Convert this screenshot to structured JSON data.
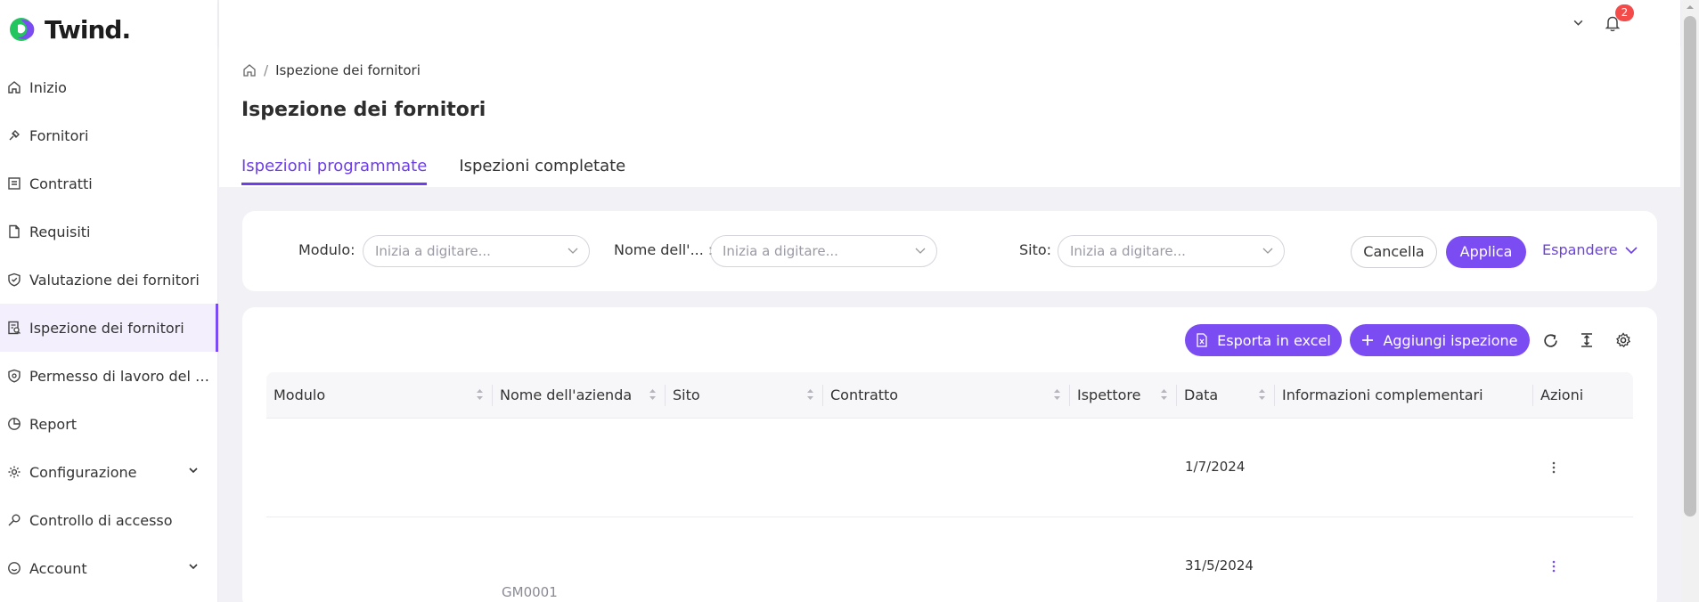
{
  "brand": {
    "name": "Twind.",
    "logo_colors": [
      "#22c55e",
      "#7b4cf2"
    ]
  },
  "sidebar": {
    "items": [
      {
        "label": "Inizio",
        "icon": "home-icon"
      },
      {
        "label": "Fornitori",
        "icon": "pin-icon"
      },
      {
        "label": "Contratti",
        "icon": "contract-icon"
      },
      {
        "label": "Requisiti",
        "icon": "document-icon"
      },
      {
        "label": "Valutazione dei fornitori",
        "icon": "shield-check-icon"
      },
      {
        "label": "Ispezione dei fornitori",
        "icon": "inspection-icon",
        "active": true
      },
      {
        "label": "Permesso di lavoro del f...",
        "icon": "shield-icon"
      },
      {
        "label": "Report",
        "icon": "chart-pie-icon"
      },
      {
        "label": "Configurazione",
        "icon": "gear-icon",
        "expandable": true
      },
      {
        "label": "Controllo di accesso",
        "icon": "key-icon"
      },
      {
        "label": "Account",
        "icon": "smile-icon",
        "expandable": true
      }
    ]
  },
  "topbar": {
    "notifications_count": "2"
  },
  "breadcrumb": {
    "current": "Ispezione dei fornitori"
  },
  "page": {
    "title": "Ispezione dei fornitori"
  },
  "tabs": [
    {
      "label": "Ispezioni programmate",
      "active": true
    },
    {
      "label": "Ispezioni completate",
      "active": false
    }
  ],
  "filters": {
    "modulo": {
      "label": "Modulo",
      "placeholder": "Inizia a digitare..."
    },
    "nome": {
      "label": "Nome dell'...",
      "placeholder": "Inizia a digitare..."
    },
    "sito": {
      "label": "Sito",
      "placeholder": "Inizia a digitare..."
    },
    "cancel_label": "Cancella",
    "apply_label": "Applica",
    "expand_label": "Espandere"
  },
  "toolbar": {
    "export_label": "Esporta in excel",
    "add_label": "Aggiungi ispezione"
  },
  "table": {
    "columns": [
      "Modulo",
      "Nome dell'azienda",
      "Sito",
      "Contratto",
      "Ispettore",
      "Data",
      "Informazioni complementari",
      "Azioni"
    ],
    "rows": [
      {
        "data": "1/7/2024",
        "nome": ""
      },
      {
        "data": "31/5/2024",
        "nome": "GM0001"
      }
    ]
  },
  "colors": {
    "accent": "#7b4cf2",
    "danger": "#f34a4a"
  }
}
